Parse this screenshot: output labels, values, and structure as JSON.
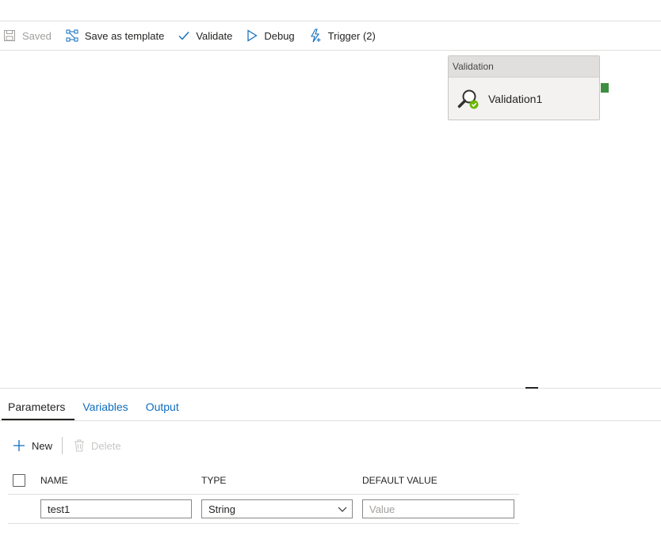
{
  "toolbar": {
    "saved_label": "Saved",
    "save_template_label": "Save as template",
    "validate_label": "Validate",
    "debug_label": "Debug",
    "trigger_label": "Trigger (2)"
  },
  "canvas": {
    "activity": {
      "type_label": "Validation",
      "name": "Validation1",
      "icon": "magnifier-check-icon",
      "port_color": "#3e8e41"
    }
  },
  "panel": {
    "tabs": [
      {
        "label": "Parameters",
        "active": true
      },
      {
        "label": "Variables",
        "active": false
      },
      {
        "label": "Output",
        "active": false
      }
    ],
    "actions": {
      "new_label": "New",
      "delete_label": "Delete"
    },
    "table": {
      "headers": {
        "name": "NAME",
        "type": "TYPE",
        "default": "DEFAULT VALUE"
      },
      "rows": [
        {
          "name": "test1",
          "type": "String",
          "default_value": "",
          "default_placeholder": "Value"
        }
      ]
    }
  },
  "colors": {
    "accent": "#0f6cbd",
    "success": "#3e8e41",
    "disabled": "#a19f9d"
  }
}
